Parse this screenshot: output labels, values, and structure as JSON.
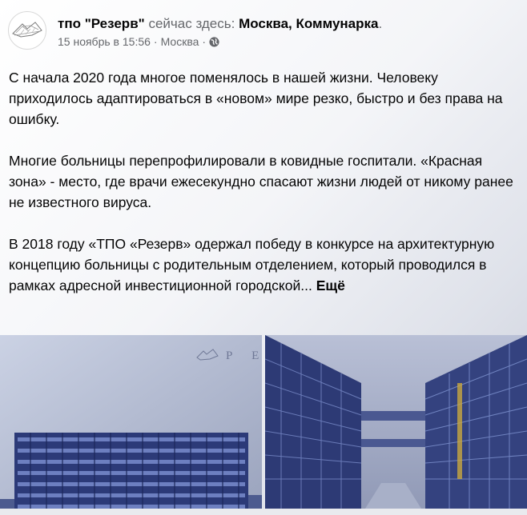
{
  "post": {
    "author": "тпо \"Резерв\"",
    "checkin_prefix": "сейчас здесь:",
    "location": "Москва, Коммунарка",
    "location_suffix": ".",
    "date": "15 ноябрь в 15:56",
    "city": "Москва",
    "separator": "·",
    "privacy_icon": "globe-icon",
    "paragraphs": [
      "С начала 2020 года многое поменялось в нашей жизни. Человеку приходилось адаптироваться в «новом» мире резко, быстро и без права на ошибку.",
      "Многие больницы перепрофилировали  в ковидные госпитали. «Красная зона» - место, где врачи ежесекундно спасают жизни людей от никому ранее не известного вируса.",
      "В 2018 году «ТПО «Резерв» одержал победу в конкурсе на архитектурную концепцию больницы с родительным отделением, который проводился в рамках адресной инвестиционной городской..."
    ],
    "more_label": "Ещё",
    "image_watermark": "Р Е"
  }
}
